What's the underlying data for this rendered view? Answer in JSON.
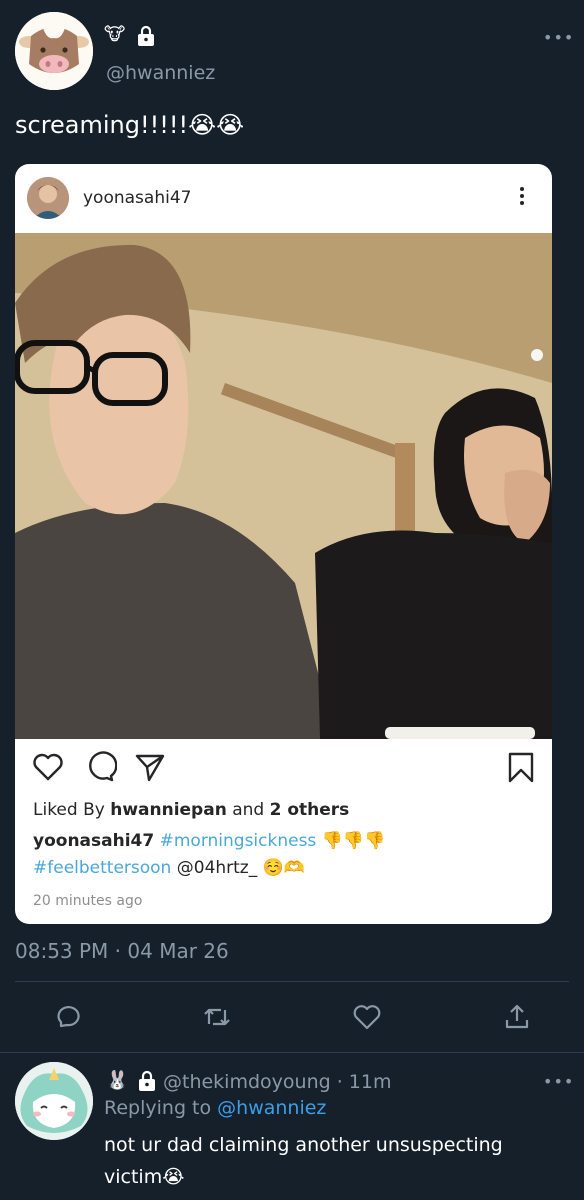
{
  "tweet": {
    "handle": "@hwanniez",
    "name_emoji": "🐮",
    "lock_label": "protected",
    "text": "screaming!!!!!😭😭",
    "more_label": "•••",
    "timestamp": "08:53 PM · 04 Mar 26"
  },
  "instagram": {
    "username": "yoonasahi47",
    "liked_prefix": "Liked By ",
    "liked_user": "hwanniepan",
    "liked_mid": " and ",
    "liked_others": "2 others",
    "caption_user": "yoonasahi47",
    "hashtag1": "#morningsickness",
    "caption_emoji1": "👎👎👎",
    "hashtag2": "#feelbettersoon",
    "mention": "@04hrtz_",
    "caption_emoji2": "☺️🫶",
    "time_ago": "20 minutes ago"
  },
  "actions": {
    "icons": [
      "reply-icon",
      "retweet-icon",
      "like-icon",
      "share-icon"
    ]
  },
  "reply": {
    "name_emoji": "🐰",
    "handle": "@thekimdoyoung",
    "separator": " · ",
    "time": "11m",
    "replying_prefix": "Replying to ",
    "replying_to": "@hwanniez",
    "text": "not ur dad claiming another unsuspecting victim😭",
    "more_label": "•••"
  },
  "colors": {
    "background": "#16202b",
    "muted": "#8b98a5",
    "link": "#3b9ee6",
    "hashtag": "#4aa8d8"
  }
}
